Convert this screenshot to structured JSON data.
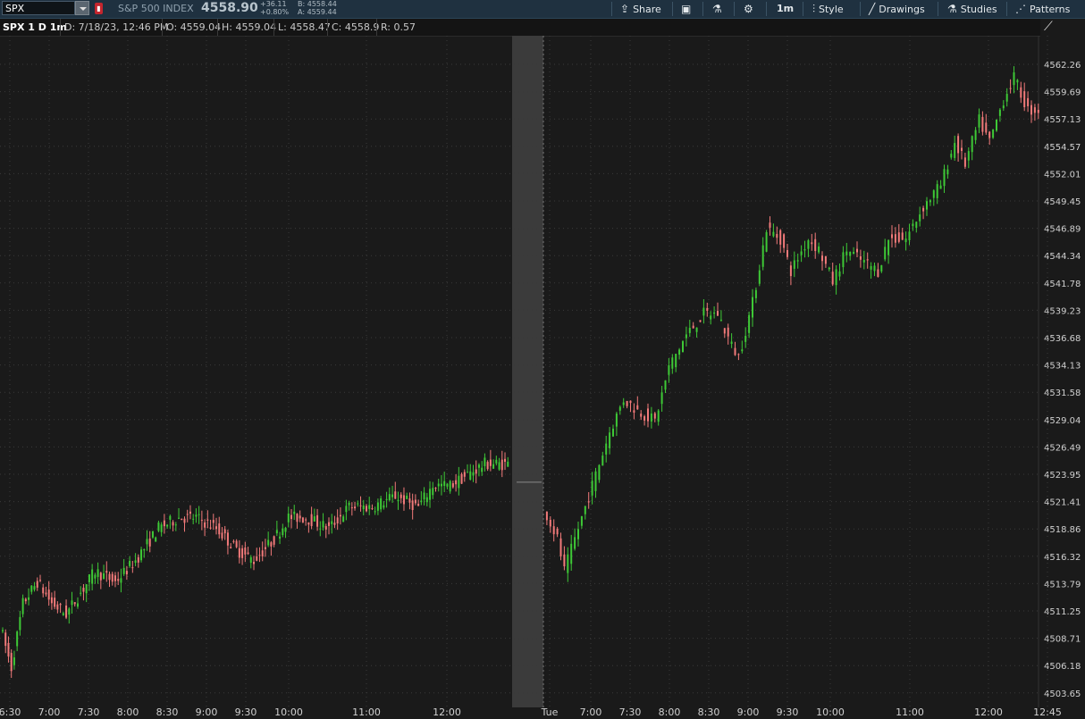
{
  "toolbar": {
    "symbol": "SPX",
    "description": "S&P 500 INDEX",
    "last": "4558.90",
    "change": "+36.11",
    "change_pct": "+0.80%",
    "bid": "B: 4558.44",
    "ask": "A: 4559.44",
    "share": "Share",
    "interval": "1m",
    "style": "Style",
    "drawings": "Drawings",
    "studies": "Studies",
    "patterns": "Patterns"
  },
  "header": {
    "symbol": "SPX 1 D 1m",
    "date": "D: 7/18/23, 12:46 PM",
    "open": "O: 4559.04",
    "high": "H: 4559.04",
    "low": "L: 4558.47",
    "close": "C: 4558.9",
    "range": "R: 0.57"
  },
  "colors": {
    "up": "#3ec936",
    "down": "#f27a7a",
    "grid": "#3a3a3a",
    "session_gap": "#3b3b3b"
  },
  "chart_data": {
    "type": "candlestick",
    "y_ticks": [
      "4562.26",
      "4559.69",
      "4557.13",
      "4554.57",
      "4552.01",
      "4549.45",
      "4546.89",
      "4544.34",
      "4541.78",
      "4539.23",
      "4536.68",
      "4534.13",
      "4531.58",
      "4529.04",
      "4526.49",
      "4523.95",
      "4521.41",
      "4518.86",
      "4516.32",
      "4513.79",
      "4511.25",
      "4508.71",
      "4506.18",
      "4503.65"
    ],
    "x_ticks": [
      "6:30",
      "7:00",
      "7:30",
      "8:00",
      "8:30",
      "9:00",
      "9:30",
      "10:00",
      "11:00",
      "12:00",
      "Tue",
      "7:00",
      "7:30",
      "8:00",
      "8:30",
      "9:00",
      "9:30",
      "10:00",
      "11:00",
      "12:00",
      "12:45"
    ],
    "path": [
      [
        0,
        4510
      ],
      [
        4,
        4506
      ],
      [
        8,
        4512
      ],
      [
        13,
        4514
      ],
      [
        18,
        4512
      ],
      [
        23,
        4511
      ],
      [
        28,
        4513
      ],
      [
        33,
        4515
      ],
      [
        40,
        4514
      ],
      [
        47,
        4516
      ],
      [
        55,
        4519
      ],
      [
        62,
        4520
      ],
      [
        68,
        4520
      ],
      [
        75,
        4519
      ],
      [
        82,
        4517
      ],
      [
        88,
        4516
      ],
      [
        95,
        4518
      ],
      [
        100,
        4520
      ],
      [
        106,
        4520
      ],
      [
        114,
        4519
      ],
      [
        121,
        4521
      ],
      [
        129,
        4521
      ],
      [
        137,
        4522
      ],
      [
        145,
        4521
      ],
      [
        150,
        4523
      ],
      [
        156,
        4523
      ],
      [
        162,
        4524
      ],
      [
        168,
        4525
      ],
      [
        174,
        4525
      ],
      [
        176,
        4525
      ],
      [
        178,
        4521
      ],
      [
        182,
        4518
      ],
      [
        184,
        4515
      ],
      [
        189,
        4520
      ],
      [
        193,
        4524
      ],
      [
        197,
        4528
      ],
      [
        201,
        4531
      ],
      [
        205,
        4530
      ],
      [
        210,
        4529
      ],
      [
        214,
        4534
      ],
      [
        219,
        4537
      ],
      [
        224,
        4539
      ],
      [
        228,
        4539
      ],
      [
        232,
        4536
      ],
      [
        234,
        4535
      ],
      [
        238,
        4540
      ],
      [
        242,
        4547
      ],
      [
        246,
        4546
      ],
      [
        249,
        4543
      ],
      [
        254,
        4546
      ],
      [
        257,
        4545
      ],
      [
        261,
        4542
      ],
      [
        265,
        4545
      ],
      [
        269,
        4544
      ],
      [
        274,
        4543
      ],
      [
        277,
        4546
      ],
      [
        282,
        4546
      ],
      [
        287,
        4549
      ],
      [
        292,
        4551
      ],
      [
        296,
        4555
      ],
      [
        299,
        4553
      ],
      [
        303,
        4557
      ],
      [
        306,
        4555
      ],
      [
        310,
        4559
      ],
      [
        313,
        4561
      ],
      [
        317,
        4558
      ],
      [
        320,
        4558
      ]
    ]
  }
}
